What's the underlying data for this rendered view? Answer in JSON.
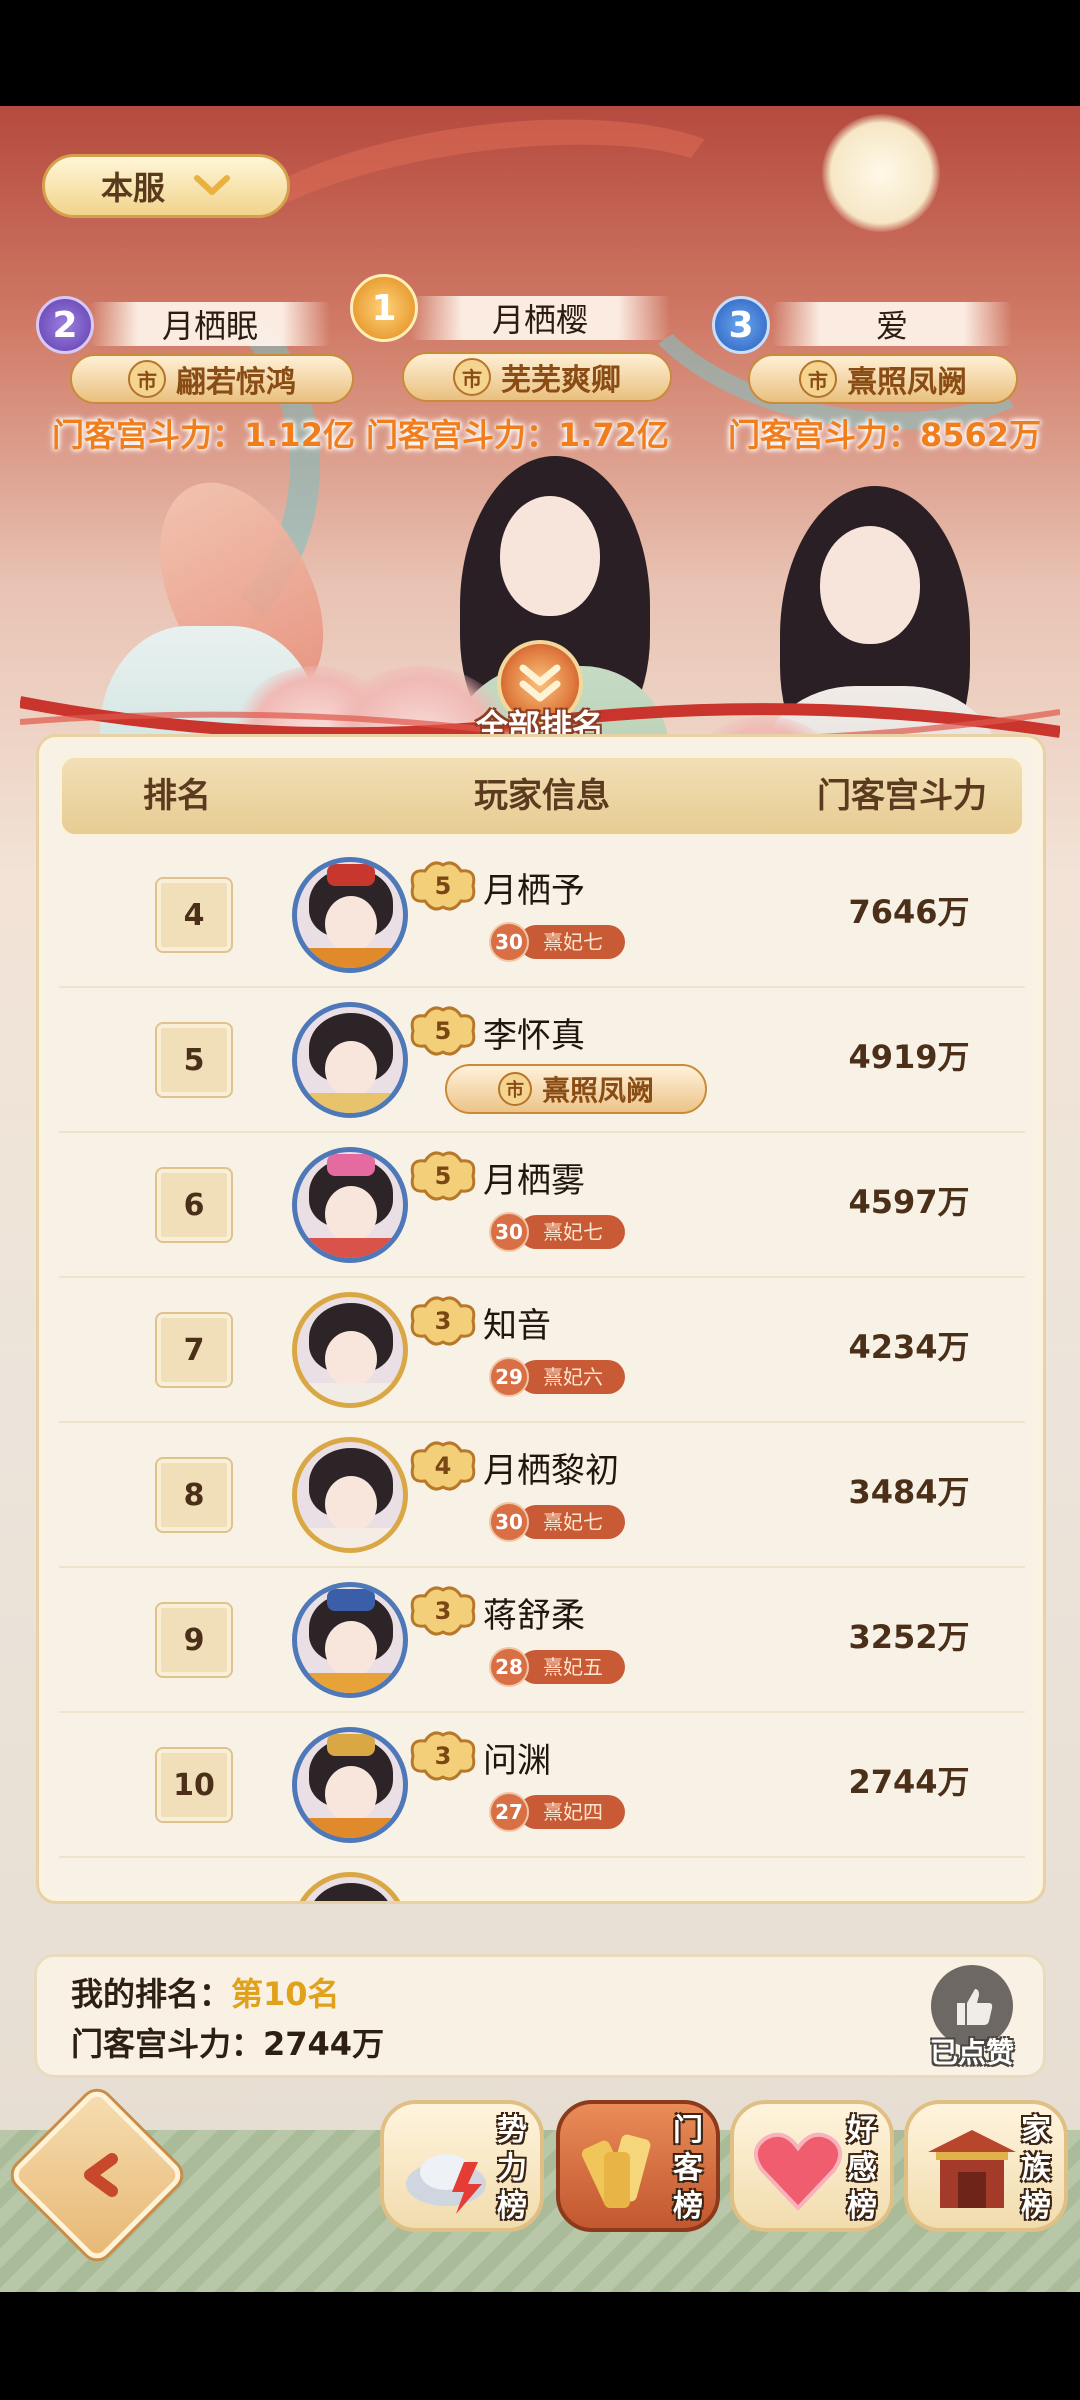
{
  "server_selector": {
    "label": "本服"
  },
  "top3": [
    {
      "rank": "2",
      "name": "月栖眠",
      "city_badge": "市",
      "title": "翩若惊鸿",
      "power": "门客宫斗力：1.12亿",
      "medal_color": "#7b5bc8"
    },
    {
      "rank": "1",
      "name": "月栖樱",
      "city_badge": "市",
      "title": "芜芜爽卿",
      "power": "门客宫斗力：1.72亿",
      "medal_color": "#e89a2a"
    },
    {
      "rank": "3",
      "name": "爱",
      "city_badge": "市",
      "title": "熹照凤阙",
      "power": "门客宫斗力：8562万",
      "medal_color": "#3e7bd8"
    }
  ],
  "all_ranking_label": "全部排名",
  "table": {
    "headers": {
      "rank": "排名",
      "player": "玩家信息",
      "power": "门客宫斗力"
    },
    "rows": [
      {
        "rank": "4",
        "level": "5",
        "name": "月栖予",
        "vip_level": "30",
        "vip_title": "熹妃七",
        "power": "7646万",
        "frame": "blue"
      },
      {
        "rank": "5",
        "level": "5",
        "name": "李怀真",
        "city_badge": "市",
        "title": "熹照凤阙",
        "power": "4919万",
        "frame": "blue"
      },
      {
        "rank": "6",
        "level": "5",
        "name": "月栖雾",
        "vip_level": "30",
        "vip_title": "熹妃七",
        "power": "4597万",
        "frame": "blue"
      },
      {
        "rank": "7",
        "level": "3",
        "name": "知音",
        "vip_level": "29",
        "vip_title": "熹妃六",
        "power": "4234万",
        "frame": "gold"
      },
      {
        "rank": "8",
        "level": "4",
        "name": "月栖黎初",
        "vip_level": "30",
        "vip_title": "熹妃七",
        "power": "3484万",
        "frame": "gold"
      },
      {
        "rank": "9",
        "level": "3",
        "name": "蒋舒柔",
        "vip_level": "28",
        "vip_title": "熹妃五",
        "power": "3252万",
        "frame": "blue"
      },
      {
        "rank": "10",
        "level": "3",
        "name": "问渊",
        "vip_level": "27",
        "vip_title": "熹妃四",
        "power": "2744万",
        "frame": "blue"
      }
    ]
  },
  "my_rank": {
    "label": "我的排名：",
    "value": "第10名",
    "power": "门客宫斗力：2744万",
    "like_label": "已点赞"
  },
  "bottom_nav": [
    {
      "label": "势力榜",
      "icon": "silver-ingot-icon",
      "active": false
    },
    {
      "label": "门客榜",
      "icon": "scroll-icon",
      "active": true
    },
    {
      "label": "好感榜",
      "icon": "heart-icon",
      "active": false
    },
    {
      "label": "家族榜",
      "icon": "palace-gate-icon",
      "active": false
    }
  ]
}
